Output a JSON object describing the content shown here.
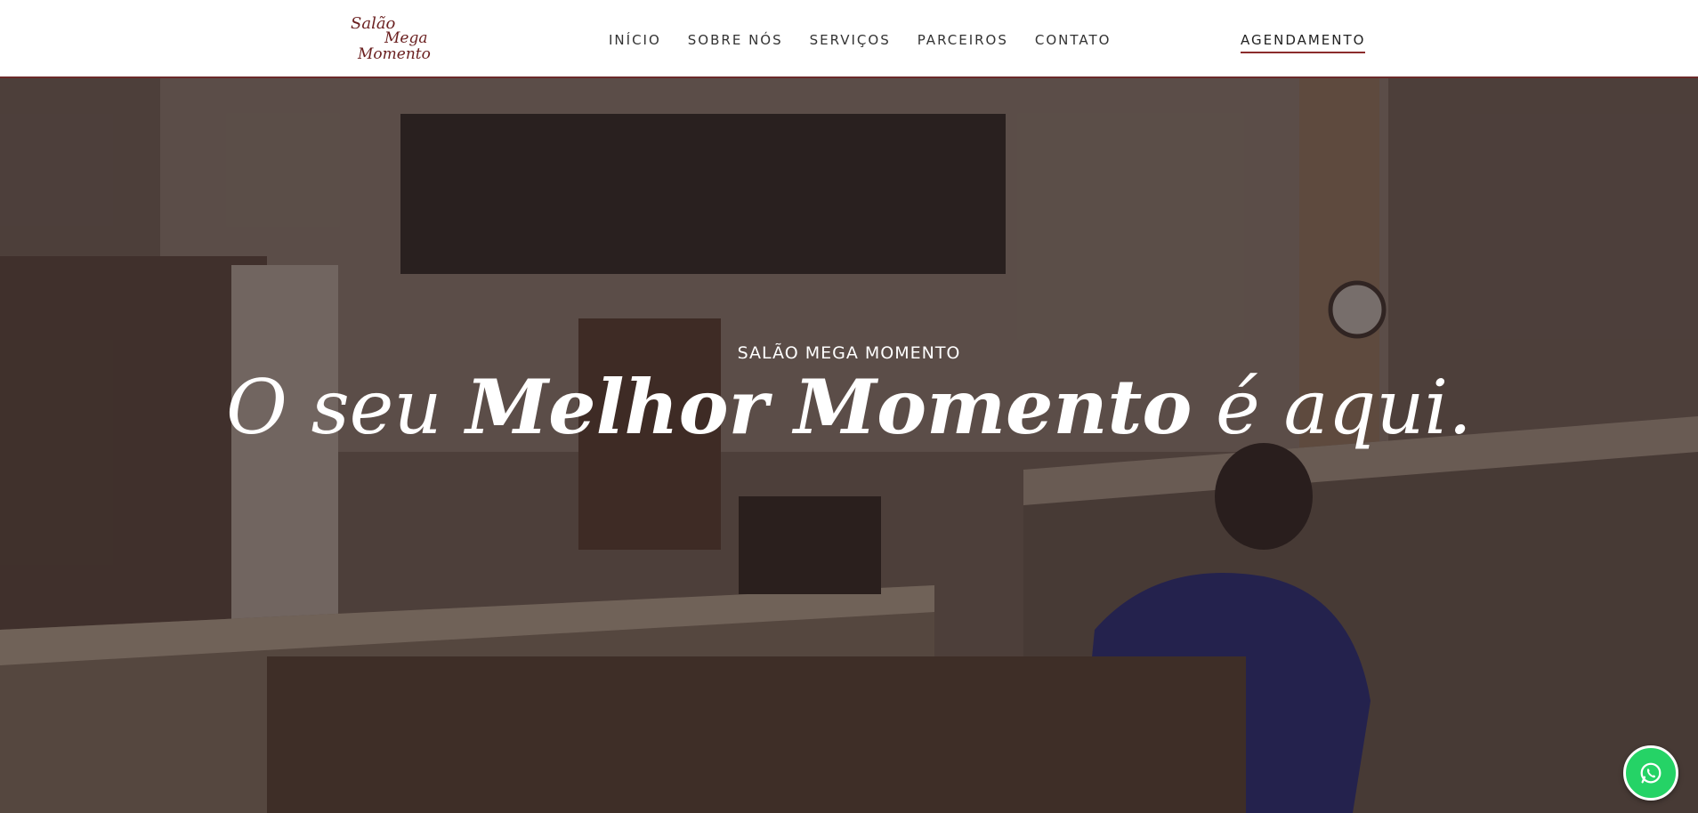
{
  "header": {
    "logo_lines": [
      "Salão",
      "Mega",
      "Momento"
    ],
    "nav": [
      {
        "label": "INÍCIO"
      },
      {
        "label": "SOBRE NÓS"
      },
      {
        "label": "SERVIÇOS"
      },
      {
        "label": "PARCEIROS"
      },
      {
        "label": "CONTATO"
      }
    ],
    "cta_label": "AGENDAMENTO"
  },
  "hero": {
    "eyebrow": "SALÃO MEGA MOMENTO",
    "headline_part1": "O seu ",
    "headline_part2": "Melhor Momento",
    "headline_part3": " é aqui."
  },
  "colors": {
    "brand": "#6a1f1f",
    "accent_underline": "#8b2c2c",
    "whatsapp": "#25d366"
  },
  "floating": {
    "icon": "whatsapp-icon"
  }
}
